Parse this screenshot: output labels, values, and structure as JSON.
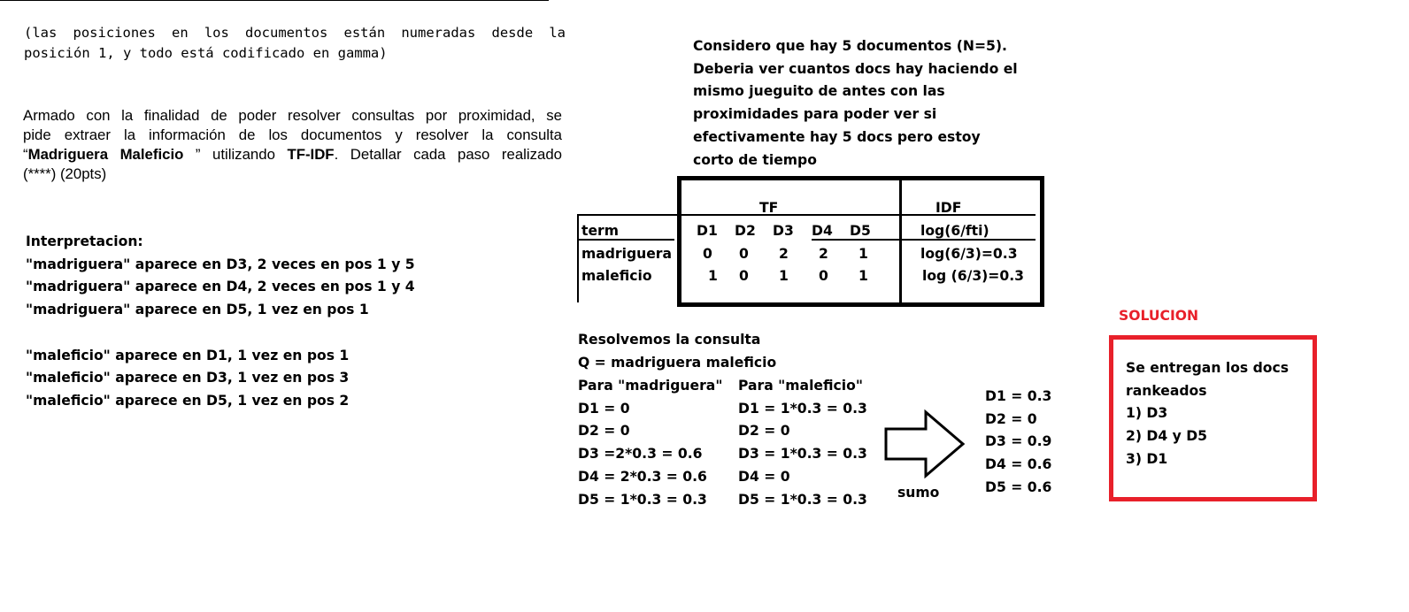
{
  "exam": {
    "note_line1": "(las posiciones en los documentos están numeradas desde la",
    "note_line2": "posición 1, y todo está codificado en gamma)",
    "task_line1": "Armado con la finalidad de poder resolver consultas por proximidad, se",
    "task_line2": "pide extraer la información de los documentos y resolver la consulta",
    "task_l3_a": "“",
    "task_l3_b": "Madriguera Maleficio",
    "task_l3_c": " ” utilizando ",
    "task_l3_d": "TF-IDF",
    "task_l3_e": ". Detallar cada paso realizado",
    "task_line4": "(****) (20pts)"
  },
  "interpretation": {
    "title": "Interpretacion:",
    "lines": [
      "\"madriguera\" aparece en D3, 2 veces en pos 1 y 5",
      "\"madriguera\" aparece en D4, 2 veces en pos 1 y 4",
      "\"madriguera\" aparece en D5, 1 vez en pos 1",
      "\"maleficio\" aparece en D1, 1 vez en pos 1",
      "\"maleficio\" aparece en D3, 1 vez en pos 3",
      "\"maleficio\" aparece en D5, 1 vez en pos 2"
    ]
  },
  "consideration": {
    "lines": [
      "Considero que hay 5 documentos (N=5).",
      "Deberia ver cuantos docs hay haciendo el",
      "mismo jueguito de antes con las",
      "proximidades para poder ver si",
      "efectivamente hay 5 docs pero estoy",
      "corto de tiempo"
    ]
  },
  "table": {
    "tf_header": "TF",
    "idf_header": "IDF",
    "term_header": "term",
    "doc_headers": [
      "D1",
      "D2",
      "D3",
      "D4",
      "D5"
    ],
    "idf_formula": "log(6/fti)",
    "rows": [
      {
        "term": "madriguera",
        "tf": [
          "0",
          "0",
          "2",
          "2",
          "1"
        ],
        "idf": "log(6/3)=0.3"
      },
      {
        "term": "maleficio",
        "tf": [
          "1",
          "0",
          "1",
          "0",
          "1"
        ],
        "idf": "log (6/3)=0.3"
      }
    ]
  },
  "resolution": {
    "title": "Resolvemos la consulta",
    "query": "Q = madriguera maleficio",
    "col1_header": "Para \"madriguera\"",
    "col1": [
      "D1 = 0",
      "D2 = 0",
      "D3 =2*0.3 = 0.6",
      "D4 = 2*0.3 = 0.6",
      "D5 = 1*0.3 = 0.3"
    ],
    "col2_header": "Para \"maleficio\"",
    "col2": [
      "D1 = 1*0.3 = 0.3",
      "D2 = 0",
      "D3 = 1*0.3 = 0.3",
      "D4 = 0",
      "D5 = 1*0.3 = 0.3"
    ],
    "arrow_label": "sumo",
    "sums": [
      "D1 = 0.3",
      "D2 = 0",
      "D3 = 0.9",
      "D4 = 0.6",
      "D5 = 0.6"
    ]
  },
  "solution": {
    "label": "SOLUCION",
    "label_color": "#e8202a",
    "box_color": "#e8202a",
    "lines": [
      "Se entregan los docs",
      "rankeados",
      "1) D3",
      "2) D4 y D5",
      "3) D1"
    ]
  }
}
